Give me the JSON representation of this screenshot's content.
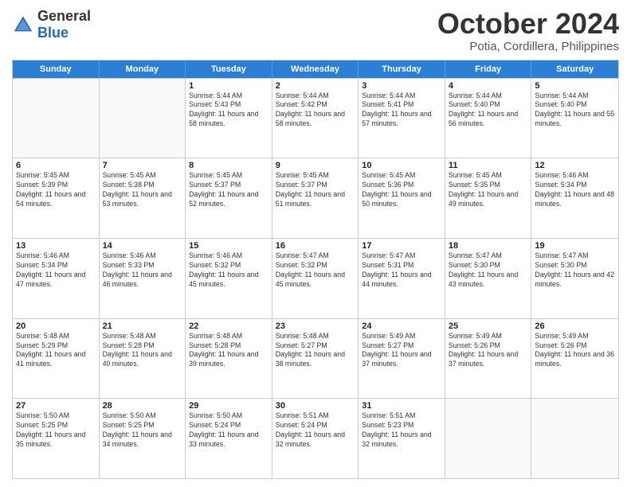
{
  "logo": {
    "general": "General",
    "blue": "Blue"
  },
  "title": "October 2024",
  "subtitle": "Potia, Cordillera, Philippines",
  "header_days": [
    "Sunday",
    "Monday",
    "Tuesday",
    "Wednesday",
    "Thursday",
    "Friday",
    "Saturday"
  ],
  "weeks": [
    [
      {
        "day": "",
        "sunrise": "",
        "sunset": "",
        "daylight": ""
      },
      {
        "day": "",
        "sunrise": "",
        "sunset": "",
        "daylight": ""
      },
      {
        "day": "1",
        "sunrise": "Sunrise: 5:44 AM",
        "sunset": "Sunset: 5:43 PM",
        "daylight": "Daylight: 11 hours and 58 minutes."
      },
      {
        "day": "2",
        "sunrise": "Sunrise: 5:44 AM",
        "sunset": "Sunset: 5:42 PM",
        "daylight": "Daylight: 11 hours and 58 minutes."
      },
      {
        "day": "3",
        "sunrise": "Sunrise: 5:44 AM",
        "sunset": "Sunset: 5:41 PM",
        "daylight": "Daylight: 11 hours and 57 minutes."
      },
      {
        "day": "4",
        "sunrise": "Sunrise: 5:44 AM",
        "sunset": "Sunset: 5:40 PM",
        "daylight": "Daylight: 11 hours and 56 minutes."
      },
      {
        "day": "5",
        "sunrise": "Sunrise: 5:44 AM",
        "sunset": "Sunset: 5:40 PM",
        "daylight": "Daylight: 11 hours and 55 minutes."
      }
    ],
    [
      {
        "day": "6",
        "sunrise": "Sunrise: 5:45 AM",
        "sunset": "Sunset: 5:39 PM",
        "daylight": "Daylight: 11 hours and 54 minutes."
      },
      {
        "day": "7",
        "sunrise": "Sunrise: 5:45 AM",
        "sunset": "Sunset: 5:38 PM",
        "daylight": "Daylight: 11 hours and 53 minutes."
      },
      {
        "day": "8",
        "sunrise": "Sunrise: 5:45 AM",
        "sunset": "Sunset: 5:37 PM",
        "daylight": "Daylight: 11 hours and 52 minutes."
      },
      {
        "day": "9",
        "sunrise": "Sunrise: 5:45 AM",
        "sunset": "Sunset: 5:37 PM",
        "daylight": "Daylight: 11 hours and 51 minutes."
      },
      {
        "day": "10",
        "sunrise": "Sunrise: 5:45 AM",
        "sunset": "Sunset: 5:36 PM",
        "daylight": "Daylight: 11 hours and 50 minutes."
      },
      {
        "day": "11",
        "sunrise": "Sunrise: 5:45 AM",
        "sunset": "Sunset: 5:35 PM",
        "daylight": "Daylight: 11 hours and 49 minutes."
      },
      {
        "day": "12",
        "sunrise": "Sunrise: 5:46 AM",
        "sunset": "Sunset: 5:34 PM",
        "daylight": "Daylight: 11 hours and 48 minutes."
      }
    ],
    [
      {
        "day": "13",
        "sunrise": "Sunrise: 5:46 AM",
        "sunset": "Sunset: 5:34 PM",
        "daylight": "Daylight: 11 hours and 47 minutes."
      },
      {
        "day": "14",
        "sunrise": "Sunrise: 5:46 AM",
        "sunset": "Sunset: 5:33 PM",
        "daylight": "Daylight: 11 hours and 46 minutes."
      },
      {
        "day": "15",
        "sunrise": "Sunrise: 5:46 AM",
        "sunset": "Sunset: 5:32 PM",
        "daylight": "Daylight: 11 hours and 45 minutes."
      },
      {
        "day": "16",
        "sunrise": "Sunrise: 5:47 AM",
        "sunset": "Sunset: 5:32 PM",
        "daylight": "Daylight: 11 hours and 45 minutes."
      },
      {
        "day": "17",
        "sunrise": "Sunrise: 5:47 AM",
        "sunset": "Sunset: 5:31 PM",
        "daylight": "Daylight: 11 hours and 44 minutes."
      },
      {
        "day": "18",
        "sunrise": "Sunrise: 5:47 AM",
        "sunset": "Sunset: 5:30 PM",
        "daylight": "Daylight: 11 hours and 43 minutes."
      },
      {
        "day": "19",
        "sunrise": "Sunrise: 5:47 AM",
        "sunset": "Sunset: 5:30 PM",
        "daylight": "Daylight: 11 hours and 42 minutes."
      }
    ],
    [
      {
        "day": "20",
        "sunrise": "Sunrise: 5:48 AM",
        "sunset": "Sunset: 5:29 PM",
        "daylight": "Daylight: 11 hours and 41 minutes."
      },
      {
        "day": "21",
        "sunrise": "Sunrise: 5:48 AM",
        "sunset": "Sunset: 5:28 PM",
        "daylight": "Daylight: 11 hours and 40 minutes."
      },
      {
        "day": "22",
        "sunrise": "Sunrise: 5:48 AM",
        "sunset": "Sunset: 5:28 PM",
        "daylight": "Daylight: 11 hours and 39 minutes."
      },
      {
        "day": "23",
        "sunrise": "Sunrise: 5:48 AM",
        "sunset": "Sunset: 5:27 PM",
        "daylight": "Daylight: 11 hours and 38 minutes."
      },
      {
        "day": "24",
        "sunrise": "Sunrise: 5:49 AM",
        "sunset": "Sunset: 5:27 PM",
        "daylight": "Daylight: 11 hours and 37 minutes."
      },
      {
        "day": "25",
        "sunrise": "Sunrise: 5:49 AM",
        "sunset": "Sunset: 5:26 PM",
        "daylight": "Daylight: 11 hours and 37 minutes."
      },
      {
        "day": "26",
        "sunrise": "Sunrise: 5:49 AM",
        "sunset": "Sunset: 5:26 PM",
        "daylight": "Daylight: 11 hours and 36 minutes."
      }
    ],
    [
      {
        "day": "27",
        "sunrise": "Sunrise: 5:50 AM",
        "sunset": "Sunset: 5:25 PM",
        "daylight": "Daylight: 11 hours and 35 minutes."
      },
      {
        "day": "28",
        "sunrise": "Sunrise: 5:50 AM",
        "sunset": "Sunset: 5:25 PM",
        "daylight": "Daylight: 11 hours and 34 minutes."
      },
      {
        "day": "29",
        "sunrise": "Sunrise: 5:50 AM",
        "sunset": "Sunset: 5:24 PM",
        "daylight": "Daylight: 11 hours and 33 minutes."
      },
      {
        "day": "30",
        "sunrise": "Sunrise: 5:51 AM",
        "sunset": "Sunset: 5:24 PM",
        "daylight": "Daylight: 11 hours and 32 minutes."
      },
      {
        "day": "31",
        "sunrise": "Sunrise: 5:51 AM",
        "sunset": "Sunset: 5:23 PM",
        "daylight": "Daylight: 11 hours and 32 minutes."
      },
      {
        "day": "",
        "sunrise": "",
        "sunset": "",
        "daylight": ""
      },
      {
        "day": "",
        "sunrise": "",
        "sunset": "",
        "daylight": ""
      }
    ]
  ]
}
